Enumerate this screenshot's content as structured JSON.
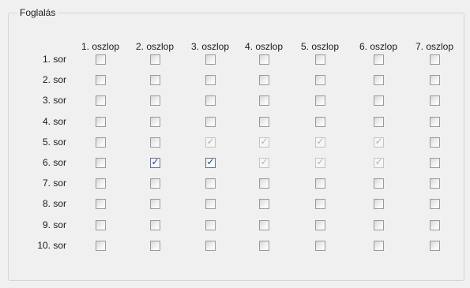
{
  "groupbox": {
    "title": "Foglalás"
  },
  "columns": [
    "1. oszlop",
    "2. oszlop",
    "3. oszlop",
    "4. oszlop",
    "5. oszlop",
    "6. oszlop",
    "7. oszlop"
  ],
  "rows": [
    "1. sor",
    "2. sor",
    "3. sor",
    "4. sor",
    "5. sor",
    "6. sor",
    "7. sor",
    "8. sor",
    "9. sor",
    "10. sor"
  ],
  "checkbox_state_legend": {
    "unchecked": "enabled, not selected",
    "checked": "enabled, selected",
    "booked": "disabled, already reserved (grey check)"
  },
  "grid": [
    [
      "unchecked",
      "unchecked",
      "unchecked",
      "unchecked",
      "unchecked",
      "unchecked",
      "unchecked"
    ],
    [
      "unchecked",
      "unchecked",
      "unchecked",
      "unchecked",
      "unchecked",
      "unchecked",
      "unchecked"
    ],
    [
      "unchecked",
      "unchecked",
      "unchecked",
      "unchecked",
      "unchecked",
      "unchecked",
      "unchecked"
    ],
    [
      "unchecked",
      "unchecked",
      "unchecked",
      "unchecked",
      "unchecked",
      "unchecked",
      "unchecked"
    ],
    [
      "unchecked",
      "unchecked",
      "booked",
      "booked",
      "booked",
      "booked",
      "unchecked"
    ],
    [
      "unchecked",
      "checked",
      "checked",
      "booked",
      "booked",
      "booked",
      "unchecked"
    ],
    [
      "unchecked",
      "unchecked",
      "unchecked",
      "unchecked",
      "unchecked",
      "unchecked",
      "unchecked"
    ],
    [
      "unchecked",
      "unchecked",
      "unchecked",
      "unchecked",
      "unchecked",
      "unchecked",
      "unchecked"
    ],
    [
      "unchecked",
      "unchecked",
      "unchecked",
      "unchecked",
      "unchecked",
      "unchecked",
      "unchecked"
    ],
    [
      "unchecked",
      "unchecked",
      "unchecked",
      "unchecked",
      "unchecked",
      "unchecked",
      "unchecked"
    ]
  ],
  "colors": {
    "check_mark": "#243c86",
    "booked_mark": "#b4b4b4"
  },
  "icons": {
    "check": "check-mark-icon"
  }
}
